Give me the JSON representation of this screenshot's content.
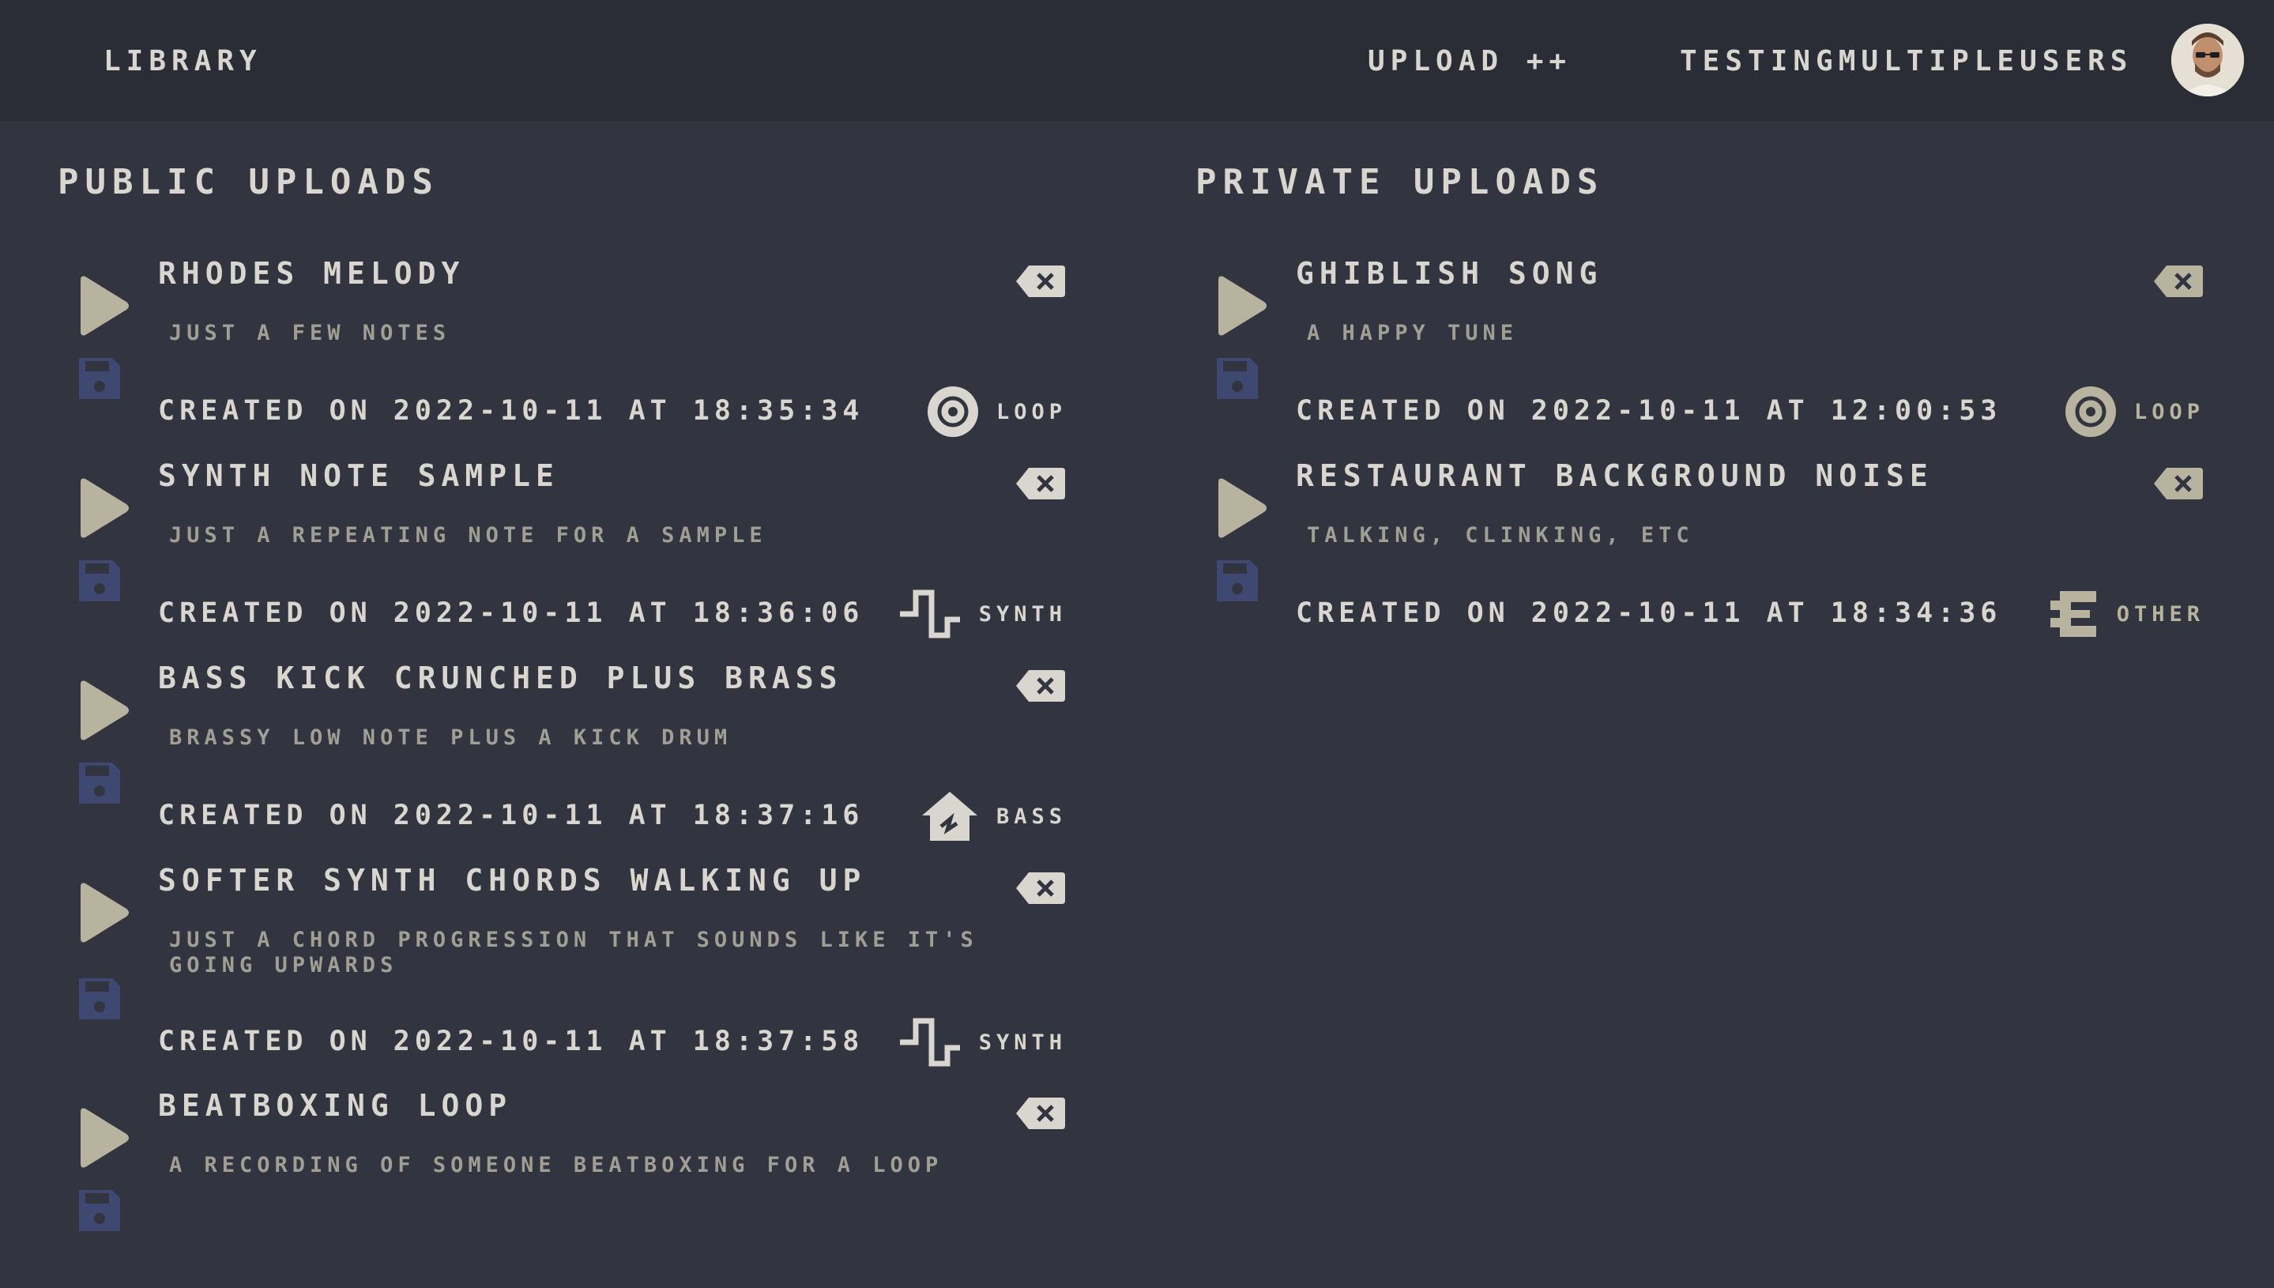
{
  "nav": {
    "library_label": "LIBRARY",
    "upload_label": "UPLOAD ++",
    "username": "TESTINGMULTIPLEUSERS"
  },
  "public": {
    "title": "PUBLIC UPLOADS",
    "items": [
      {
        "title": "RHODES MELODY",
        "description": "JUST A FEW NOTES",
        "created": "CREATED ON 2022-10-11 AT 18:35:34",
        "category": "LOOP",
        "category_icon": "loop-icon"
      },
      {
        "title": "SYNTH NOTE SAMPLE",
        "description": "JUST A REPEATING NOTE FOR A SAMPLE",
        "created": "CREATED ON 2022-10-11 AT 18:36:06",
        "category": "SYNTH",
        "category_icon": "synth-wave-icon"
      },
      {
        "title": "BASS KICK CRUNCHED PLUS BRASS",
        "description": "BRASSY LOW NOTE PLUS A KICK DRUM",
        "created": "CREATED ON 2022-10-11 AT 18:37:16",
        "category": "BASS",
        "category_icon": "bass-house-icon"
      },
      {
        "title": "SOFTER SYNTH CHORDS WALKING UP",
        "description": "JUST A CHORD PROGRESSION THAT SOUNDS LIKE IT'S GOING UPWARDS",
        "created": "CREATED ON 2022-10-11 AT 18:37:58",
        "category": "SYNTH",
        "category_icon": "synth-wave-icon"
      },
      {
        "title": "BEATBOXING LOOP",
        "description": "A RECORDING OF SOMEONE BEATBOXING FOR A LOOP",
        "created": "",
        "category": "",
        "category_icon": "loop-icon"
      }
    ]
  },
  "private": {
    "title": "PRIVATE UPLOADS",
    "items": [
      {
        "title": "GHIBLISH SONG",
        "description": "A HAPPY TUNE",
        "created": "CREATED ON 2022-10-11 AT 12:00:53",
        "category": "LOOP",
        "category_icon": "loop-icon"
      },
      {
        "title": "RESTAURANT BACKGROUND NOISE",
        "description": "TALKING, CLINKING, ETC",
        "created": "CREATED ON 2022-10-11 AT 18:34:36",
        "category": "OTHER",
        "category_icon": "other-icon"
      }
    ]
  },
  "colors": {
    "background": "#32343f",
    "navbar": "#2a2c36",
    "text": "#d9d5cf",
    "muted_text": "#a19f94",
    "icon": "#b8b39f",
    "save_icon": "#3e4870"
  }
}
